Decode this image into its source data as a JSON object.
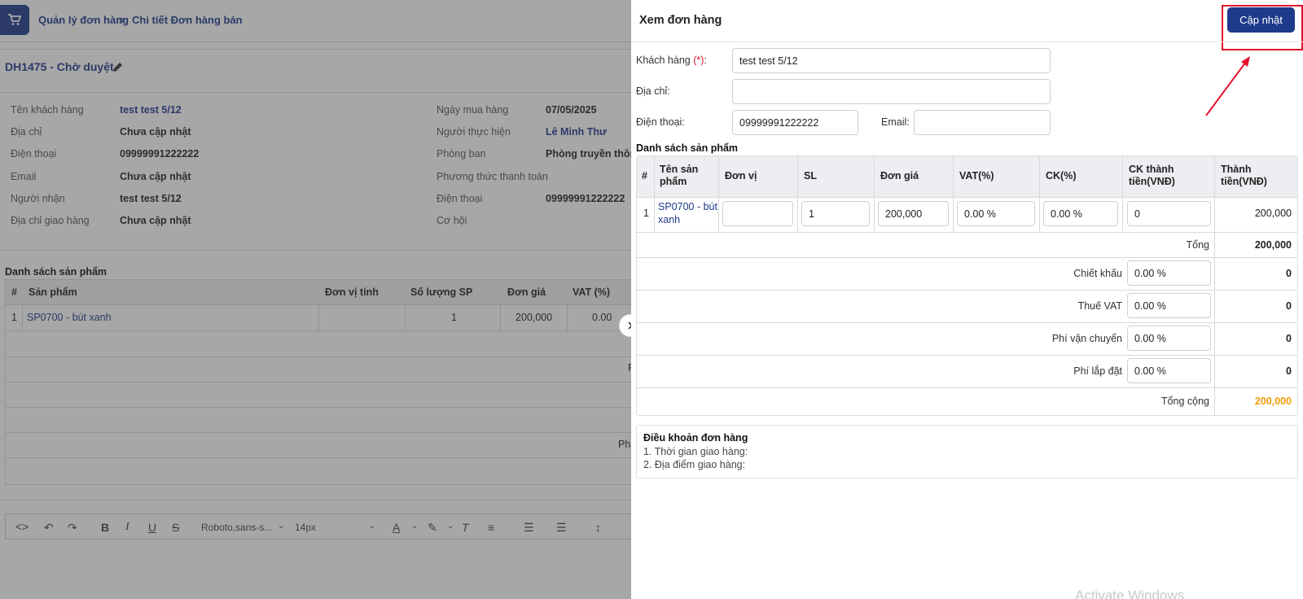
{
  "background_page": {
    "breadcrumb": {
      "root": "Quản lý đơn hàng",
      "separator": ">",
      "current": "Chi tiết Đơn hàng bán"
    },
    "order_title": "DH1475 - Chờ duyệt",
    "info_left": [
      {
        "label": "Tên khách hàng",
        "value": "test test 5/12",
        "link": true
      },
      {
        "label": "Địa chỉ",
        "value": "Chưa cập nhật",
        "link": false
      },
      {
        "label": "Điện thoại",
        "value": "09999991222222",
        "link": false
      },
      {
        "label": "Email",
        "value": "Chưa cập nhật",
        "link": false
      },
      {
        "label": "Người nhận",
        "value": "test test 5/12",
        "link": false
      },
      {
        "label": "Địa chỉ giao hàng",
        "value": "Chưa cập nhật",
        "link": false
      }
    ],
    "info_right": [
      {
        "label": "Ngày mua hàng",
        "value": "07/05/2025",
        "link": false
      },
      {
        "label": "Người thực hiện",
        "value": "Lê Minh Thư",
        "link": true
      },
      {
        "label": "Phòng ban",
        "value": "Phòng truyền thông",
        "link": false
      },
      {
        "label": "Phương thức thanh toán",
        "value": "",
        "link": false
      },
      {
        "label": "Điện thoại",
        "value": "09999991222222",
        "link": false
      },
      {
        "label": "Cơ hội",
        "value": "",
        "link": false
      }
    ],
    "products_title": "Danh sách sản phẩm",
    "table_headers": [
      "#",
      "Sản phẩm",
      "Đơn vị tính",
      "Số lượng SP",
      "Đơn giá",
      "VAT (%)"
    ],
    "table_row": {
      "index": "1",
      "product": "SP0700 - bút xanh",
      "unit": "",
      "qty": "1",
      "price": "200,000",
      "vat": "0.00"
    },
    "summary_clip": [
      "F",
      "Ph"
    ],
    "editor": {
      "font": "Roboto,sans-s...",
      "size": "14px"
    }
  },
  "panel": {
    "title": "Xem đơn hàng",
    "update_button": "Cập nhật",
    "form": {
      "customer_label": "Khách hàng",
      "required_mark": "(*)",
      "customer_suffix": ":",
      "customer_value": "test test 5/12",
      "address_label": "Địa chỉ:",
      "address_value": "",
      "phone_label": "Điện thoại:",
      "phone_value": "09999991222222",
      "email_label": "Email:",
      "email_value": ""
    },
    "products_title": "Danh sách sản phẩm",
    "table_headers": [
      "#",
      "Tên sản phẩm",
      "Đơn vị",
      "SL",
      "Đơn giá",
      "VAT(%)",
      "CK(%)",
      "CK thành tiền(VNĐ)",
      "Thành tiền(VNĐ)"
    ],
    "row": {
      "index": "1",
      "product_line1": "SP0700 - bút",
      "product_line2": "xanh",
      "unit": "",
      "qty": "1",
      "price": "200,000",
      "vat": "0.00 %",
      "ck": "0.00 %",
      "ck_amount": "0",
      "total": "200,000"
    },
    "summary": [
      {
        "label": "Tổng",
        "input": null,
        "value": "200,000"
      },
      {
        "label": "Chiết khấu",
        "input": "0.00 %",
        "value": "0"
      },
      {
        "label": "Thuế VAT",
        "input": "0.00 %",
        "value": "0"
      },
      {
        "label": "Phí vận chuyển",
        "input": "0.00 %",
        "value": "0"
      },
      {
        "label": "Phí lắp đặt",
        "input": "0.00 %",
        "value": "0"
      }
    ],
    "grand_total": {
      "label": "Tổng cộng",
      "value": "200,000"
    },
    "terms": {
      "title": "Điều khoản đơn hàng",
      "lines": [
        "1. Thời gian giao hàng:",
        "2. Địa điểm giao hàng:"
      ]
    }
  },
  "watermark": "Activate Windows",
  "colors": {
    "accent": "#1e3a8a",
    "highlight": "#e3122c",
    "grand_total": "#f59e0b"
  }
}
